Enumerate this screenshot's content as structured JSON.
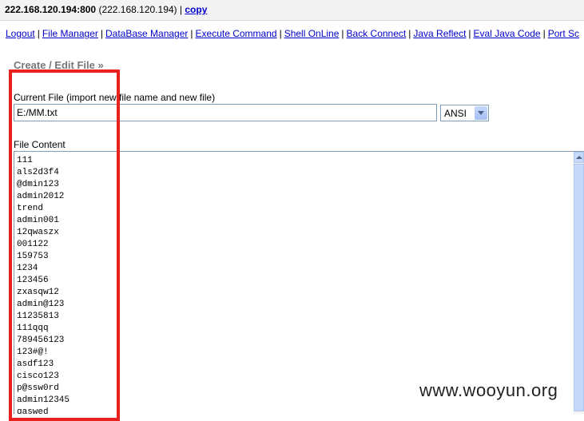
{
  "header": {
    "host": "222.168.120.194:800",
    "ip": "(222.168.120.194)",
    "separator": "|",
    "copy_link": "copy"
  },
  "nav": {
    "items": [
      "Logout",
      "File Manager",
      "DataBase Manager",
      "Execute Command",
      "Shell OnLine",
      "Back Connect",
      "Java Reflect",
      "Eval Java Code",
      "Port Sc"
    ],
    "separator": "|"
  },
  "editor": {
    "title": "Create / Edit File »",
    "current_file_label": "Current File (import new file name and new file)",
    "current_file_value": "E:/MM.txt",
    "encoding": "ANSI",
    "content_label": "File Content",
    "lines": [
      "111",
      "als2d3f4",
      "@dmin123",
      "admin2012",
      "trend",
      "admin001",
      "12qwaszx",
      "001122",
      "159753",
      "1234",
      "123456",
      "zxasqw12",
      "admin@123",
      "11235813",
      "111qqq",
      "789456123",
      "123#@!",
      "asdf123",
      "cisco123",
      "p@ssw0rd",
      "admin12345",
      "qaswed"
    ]
  },
  "watermark": "www.wooyun.org",
  "colors": {
    "link": "#0000cc",
    "highlight": "#e8201e",
    "title_gray": "#777777"
  }
}
